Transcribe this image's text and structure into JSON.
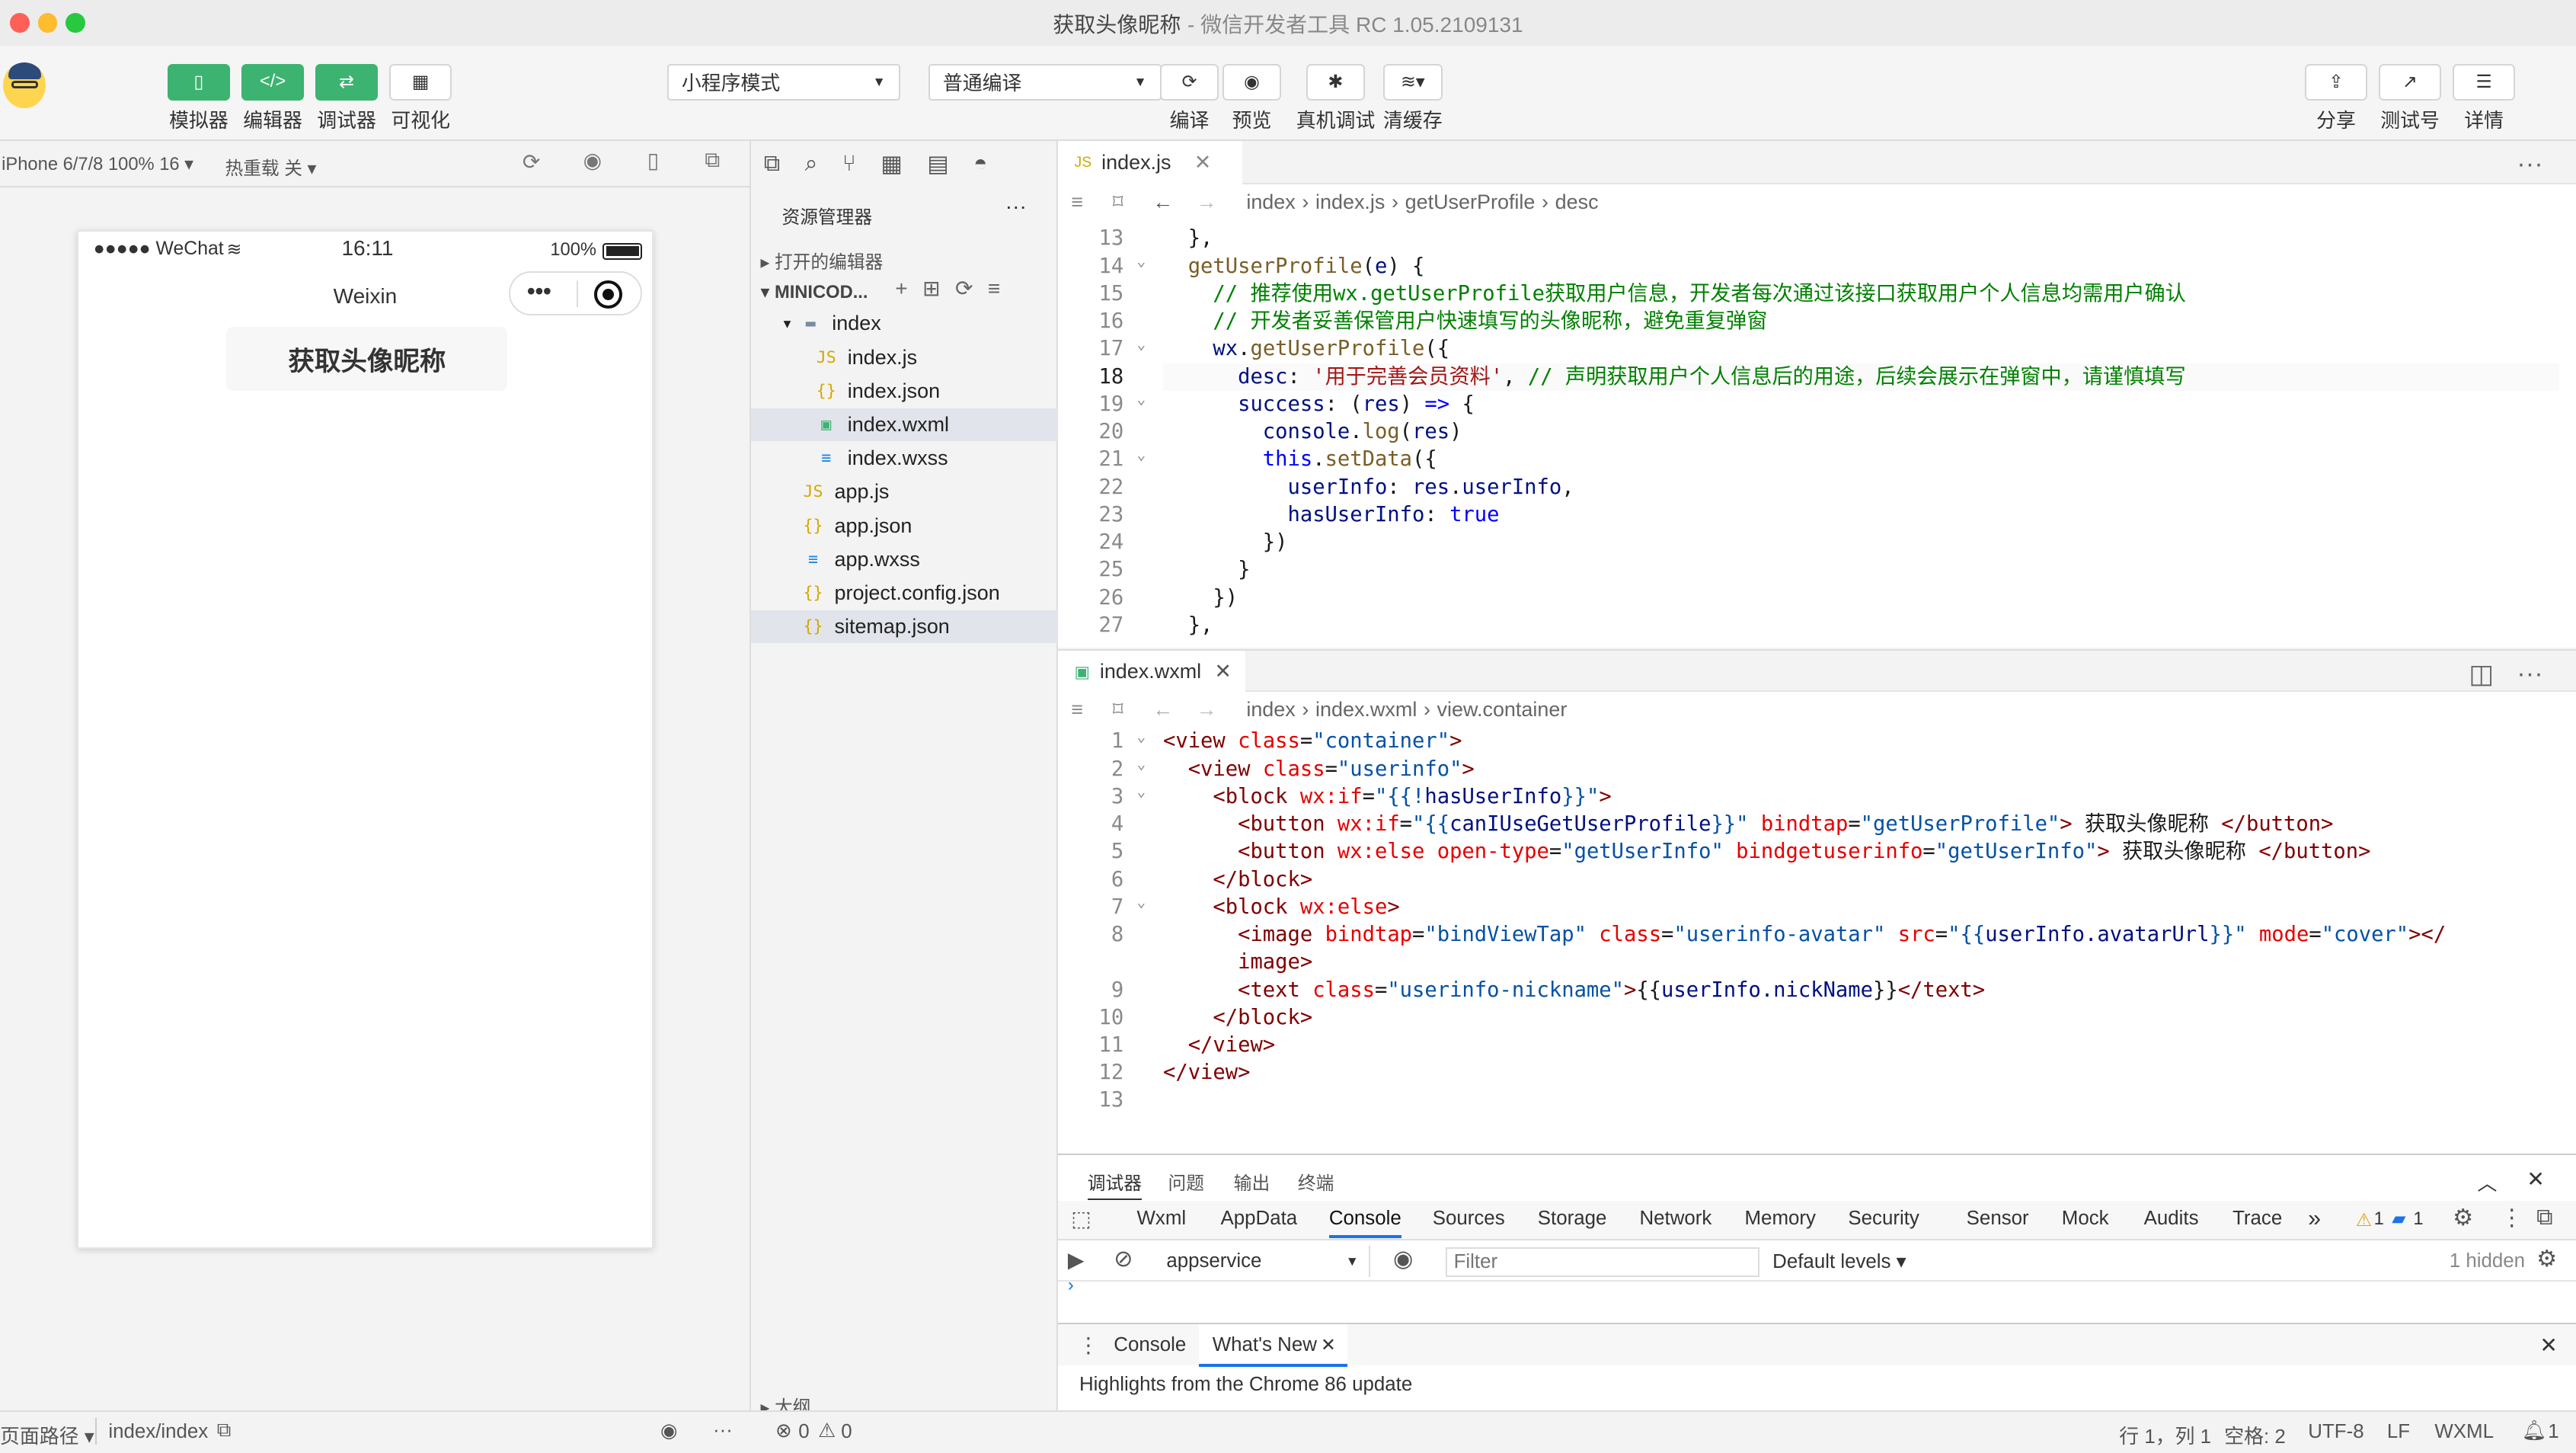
{
  "window": {
    "title": "获取头像昵称",
    "subtitle": "- 微信开发者工具 RC 1.05.2109131"
  },
  "toolbar": {
    "left": [
      {
        "label": "模拟器"
      },
      {
        "label": "编辑器"
      },
      {
        "label": "调试器"
      },
      {
        "label": "可视化"
      }
    ],
    "mode_select": "小程序模式",
    "compile_select": "普通编译",
    "mid": [
      {
        "label": "编译"
      },
      {
        "label": "预览"
      },
      {
        "label": "真机调试"
      },
      {
        "label": "清缓存"
      }
    ],
    "right": [
      {
        "label": "分享"
      },
      {
        "label": "测试号"
      },
      {
        "label": "详情"
      }
    ]
  },
  "simulator": {
    "device": "iPhone 6/7/8 100% 16 ▾",
    "hotreload": "热重载 关 ▾",
    "status_left": "●●●●● WeChat",
    "status_time": "16:11",
    "status_battery": "100%",
    "nav_title": "Weixin",
    "button_label": "获取头像昵称"
  },
  "explorer": {
    "title": "资源管理器",
    "open_editors": "打开的编辑器",
    "project": "MINICOD...",
    "items": [
      {
        "name": "index",
        "type": "folder",
        "icon": "▸"
      },
      {
        "name": "index.js",
        "type": "js"
      },
      {
        "name": "index.json",
        "type": "json"
      },
      {
        "name": "index.wxml",
        "type": "wxml"
      },
      {
        "name": "index.wxss",
        "type": "wxss"
      },
      {
        "name": "app.js",
        "type": "js"
      },
      {
        "name": "app.json",
        "type": "json"
      },
      {
        "name": "app.wxss",
        "type": "wxss"
      },
      {
        "name": "project.config.json",
        "type": "json"
      },
      {
        "name": "sitemap.json",
        "type": "json"
      }
    ],
    "outline": "大纲"
  },
  "editor1": {
    "tab": "index.js",
    "crumbs": [
      "index",
      "index.js",
      "getUserProfile",
      "desc"
    ],
    "line_numbers": [
      "13",
      "14",
      "15",
      "16",
      "17",
      "18",
      "19",
      "20",
      "21",
      "22",
      "23",
      "24",
      "25",
      "26",
      "27"
    ]
  },
  "editor2": {
    "tab": "index.wxml",
    "crumbs": [
      "index",
      "index.wxml",
      "view.container"
    ],
    "line_numbers": [
      "1",
      "2",
      "3",
      "4",
      "5",
      "6",
      "7",
      "8",
      "",
      "9",
      "10",
      "11",
      "12",
      "13"
    ]
  },
  "devtools": {
    "panel_tabs": [
      "调试器",
      "问题",
      "输出",
      "终端"
    ],
    "tabs": [
      "Wxml",
      "AppData",
      "Console",
      "Sources",
      "Storage",
      "Network",
      "Memory",
      "Security",
      "Sensor",
      "Mock",
      "Audits",
      "Trace"
    ],
    "more": "»",
    "warn_count": "1",
    "info_count": "1",
    "context": "appservice",
    "filter_placeholder": "Filter",
    "levels": "Default levels ▾",
    "hidden": "1 hidden",
    "drawer_tabs": [
      "Console",
      "What's New"
    ],
    "drawer_text": "Highlights from the Chrome 86 update"
  },
  "statusbar": {
    "path_label": "页面路径 ▾",
    "path": "index/index",
    "errors": "0",
    "warnings": "0",
    "cursor": "行 1，列 1",
    "spaces": "空格: 2",
    "encoding": "UTF-8",
    "eol": "LF",
    "lang": "WXML",
    "notif": "1"
  },
  "colors": {
    "green": "#3cb371",
    "accent": "#1a73e8",
    "tab_active": "#ffffff"
  }
}
